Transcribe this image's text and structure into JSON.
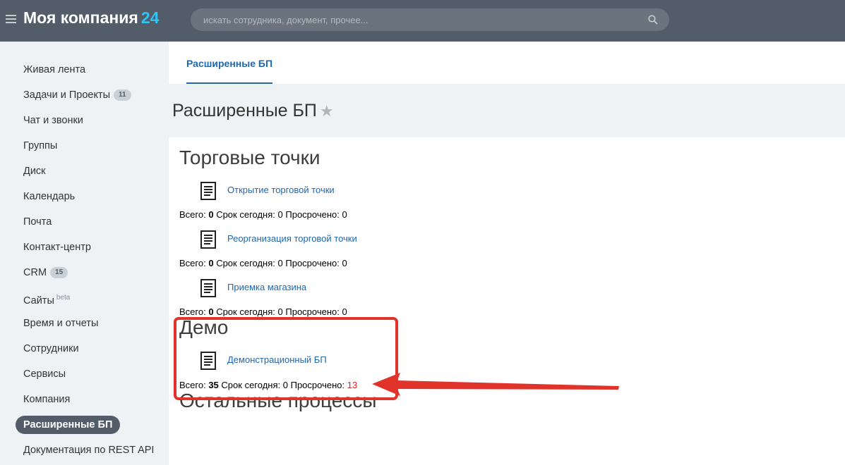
{
  "header": {
    "logo_text": "Моя компания",
    "logo_number": "24",
    "search_placeholder": "искать сотрудника, документ, прочее..."
  },
  "sidebar": {
    "items": [
      {
        "label": "Живая лента"
      },
      {
        "label": "Задачи и Проекты",
        "badge": "11"
      },
      {
        "label": "Чат и звонки"
      },
      {
        "label": "Группы"
      },
      {
        "label": "Диск"
      },
      {
        "label": "Календарь"
      },
      {
        "label": "Почта"
      },
      {
        "label": "Контакт-центр"
      },
      {
        "label": "CRM",
        "badge": "15"
      },
      {
        "label": "Сайты",
        "sup": "beta"
      },
      {
        "label": "Время и отчеты"
      },
      {
        "label": "Сотрудники"
      },
      {
        "label": "Сервисы"
      },
      {
        "label": "Компания"
      },
      {
        "label": "Расширенные БП",
        "active": true
      },
      {
        "label": "Документация по REST API"
      }
    ]
  },
  "tabs": [
    {
      "label": "Расширенные БП"
    }
  ],
  "page_title": "Расширенные БП",
  "stats_labels": {
    "total": "Всего:",
    "today": "Срок сегодня:",
    "overdue": "Просрочено:"
  },
  "sections": [
    {
      "title": "Торговые точки",
      "processes": [
        {
          "name": "Открытие торговой точки",
          "total": "0",
          "today": "0",
          "overdue": "0"
        },
        {
          "name": "Реорганизация торговой точки",
          "total": "0",
          "today": "0",
          "overdue": "0"
        },
        {
          "name": "Приемка магазина",
          "total": "0",
          "today": "0",
          "overdue": "0"
        }
      ]
    },
    {
      "title": "Демо",
      "processes": [
        {
          "name": "Демонстрационный БП",
          "total": "35",
          "today": "0",
          "overdue": "13"
        }
      ]
    },
    {
      "title": "Остальные процессы",
      "processes": []
    }
  ],
  "colors": {
    "header": "#535c69",
    "link": "#2067b0",
    "highlight": "#e0342b",
    "overdue": "#e02020"
  }
}
